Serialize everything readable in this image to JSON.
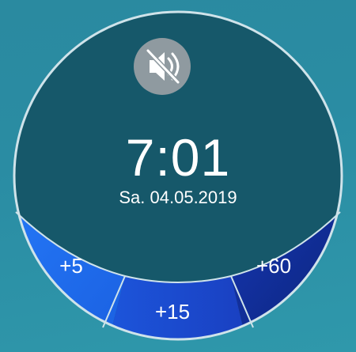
{
  "clock": {
    "time": "7:01",
    "date": "Sa. 04.05.2019"
  },
  "snooze_buttons": [
    {
      "label": "+5"
    },
    {
      "label": "+15"
    },
    {
      "label": "+60"
    }
  ],
  "mute_button": {
    "icon": "volume-off-icon"
  },
  "colors": {
    "background": "#2a8aa0",
    "dial": "#16586a",
    "ring": "#cfe3ea",
    "button_left": "#1f6ff0",
    "button_middle": "#1c4fd4",
    "button_right": "#0e2a8e",
    "mute_bg": "#8f9aa0"
  }
}
